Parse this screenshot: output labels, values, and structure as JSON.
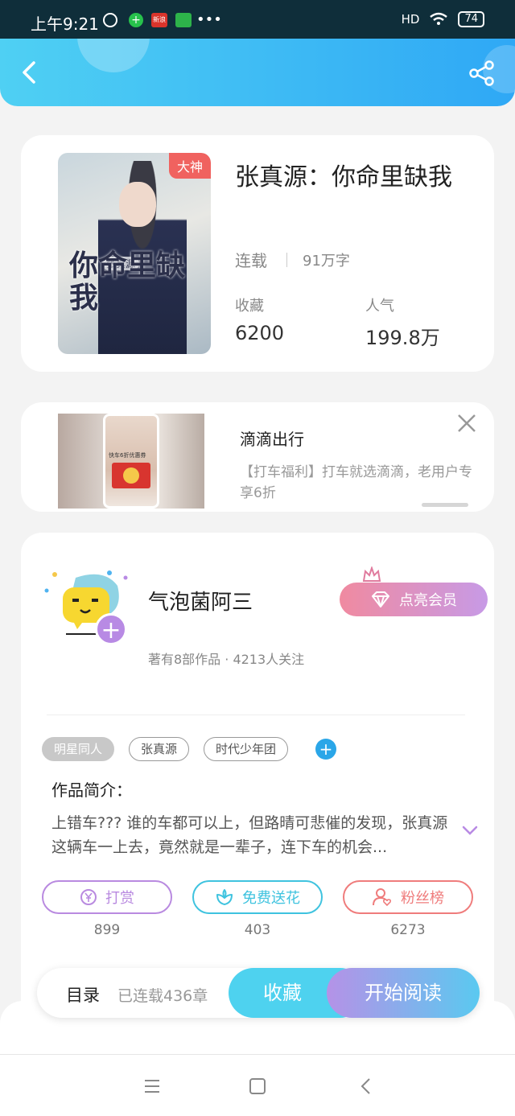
{
  "status_bar": {
    "time": "上午9:21",
    "news_icon_text": "新浪",
    "more": "•••",
    "signal": "HD",
    "battery": "74"
  },
  "book": {
    "badge": "大神",
    "cover_title": "你命里缺我",
    "cover_author": "张真源",
    "title": "张真源：你命里缺我",
    "status": "连载",
    "word_count": "91万字",
    "collect_label": "收藏",
    "collect_value": "6200",
    "popularity_label": "人气",
    "popularity_value": "199.8万"
  },
  "ad": {
    "title": "滴滴出行",
    "description": "【打车福利】打车就选滴滴，老用户专享6折",
    "image_text": "快车6折优惠券"
  },
  "author": {
    "name": "气泡菌阿三",
    "info": "著有8部作品 · 4213人关注",
    "vip_label": "点亮会员"
  },
  "tags": [
    "明星同人",
    "张真源",
    "时代少年团"
  ],
  "intro": {
    "label": "作品简介：",
    "text": "上错车??? 谁的车都可以上，但路晴可悲催的发现，张真源这辆车一上去，竟然就是一辈子，连下车的机会..."
  },
  "actions": [
    {
      "label": "打赏",
      "count": "899",
      "color": "#b98ae0",
      "icon": "yen-coin-icon"
    },
    {
      "label": "免费送花",
      "count": "403",
      "color": "#3fc3df",
      "icon": "flower-icon"
    },
    {
      "label": "粉丝榜",
      "count": "6273",
      "color": "#ef7c7c",
      "icon": "fan-user-icon"
    }
  ],
  "bottom_bar": {
    "toc_label": "目录",
    "toc_count": "已连载436章",
    "collect_label": "收藏",
    "read_label": "开始阅读"
  },
  "colors": {
    "header_start": "#4fd0f3",
    "header_end": "#2fa8f5",
    "badge": "#f0625f"
  }
}
